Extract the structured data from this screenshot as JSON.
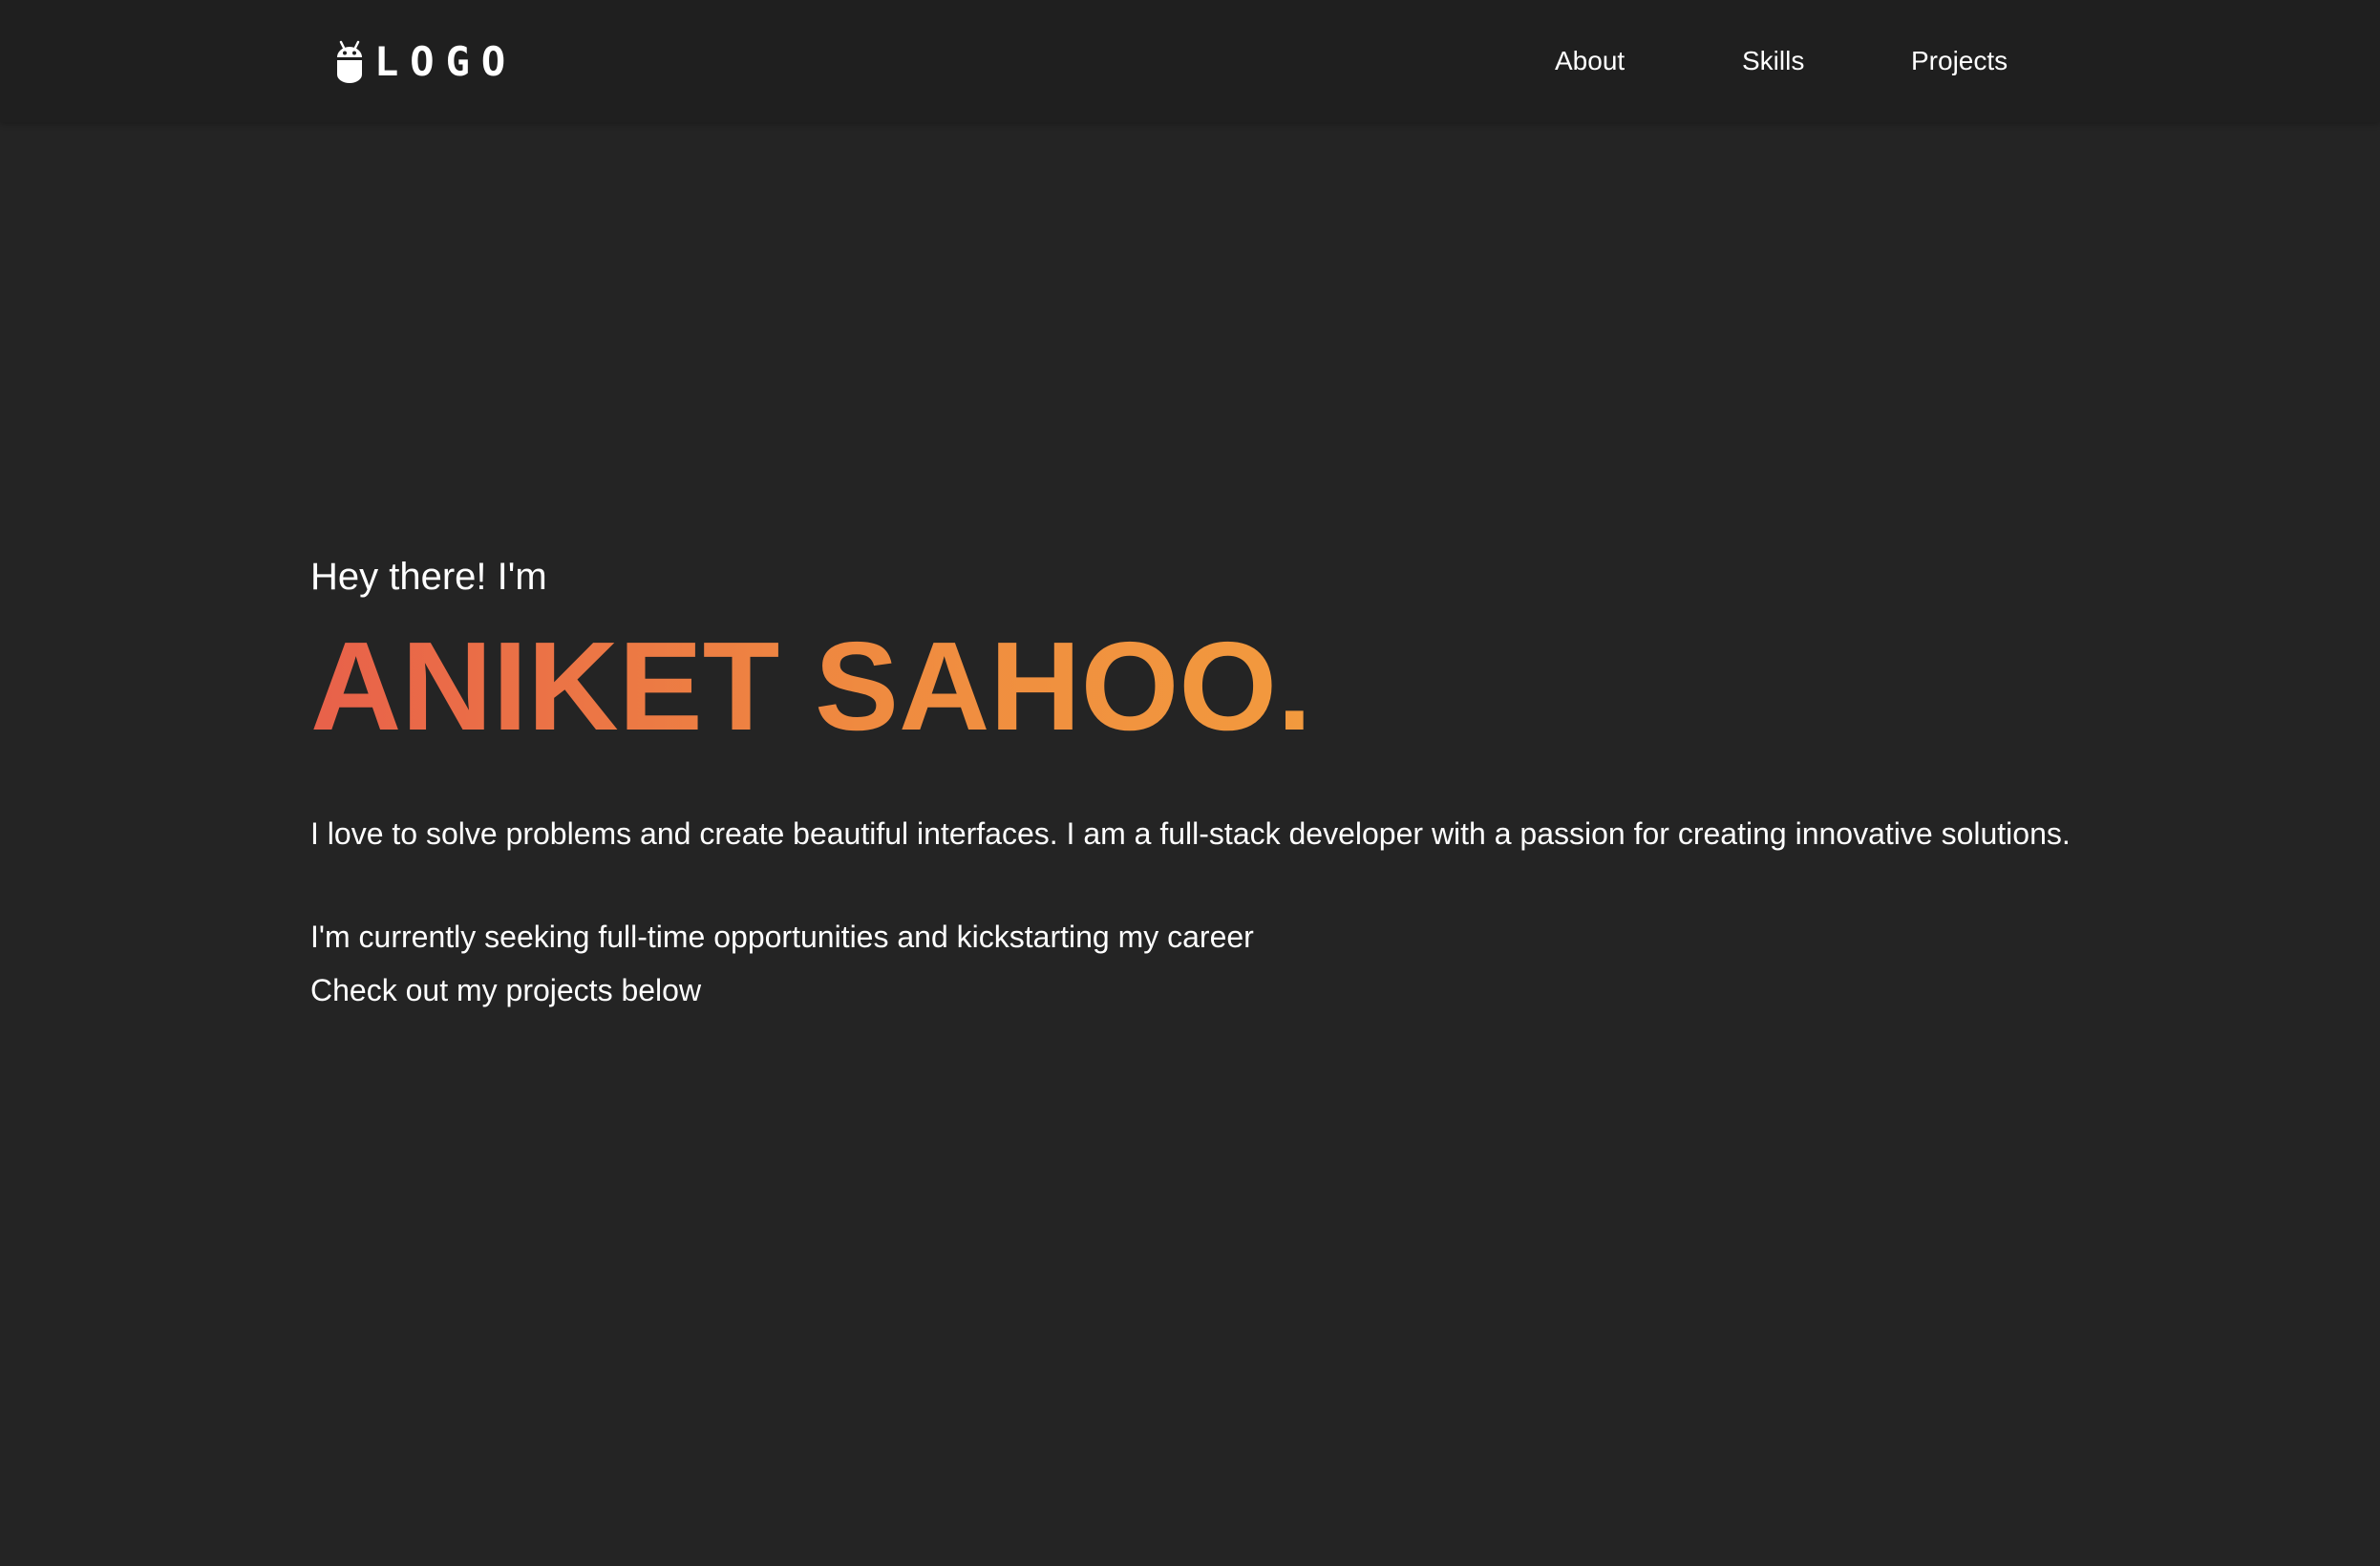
{
  "nav": {
    "logo_text": "LOGO",
    "logo_icon": "android-icon",
    "links": [
      {
        "label": "About"
      },
      {
        "label": "Skills"
      },
      {
        "label": "Projects"
      }
    ]
  },
  "hero": {
    "greeting": "Hey there! I'm",
    "name": "ANIKET SAHOO.",
    "intro": "I love to solve problems and create beautiful interfaces. I am a full-stack developer with a passion for creating innovative solutions.",
    "seeking": "I'm currently seeking full-time opportunities and kickstarting my career",
    "cta": "Check out my projects below"
  },
  "colors": {
    "background": "#242424",
    "navbar": "#1f1f1f",
    "text": "#ffffff",
    "name_gradient_start": "#e8614a",
    "name_gradient_end": "#f29a3e"
  }
}
